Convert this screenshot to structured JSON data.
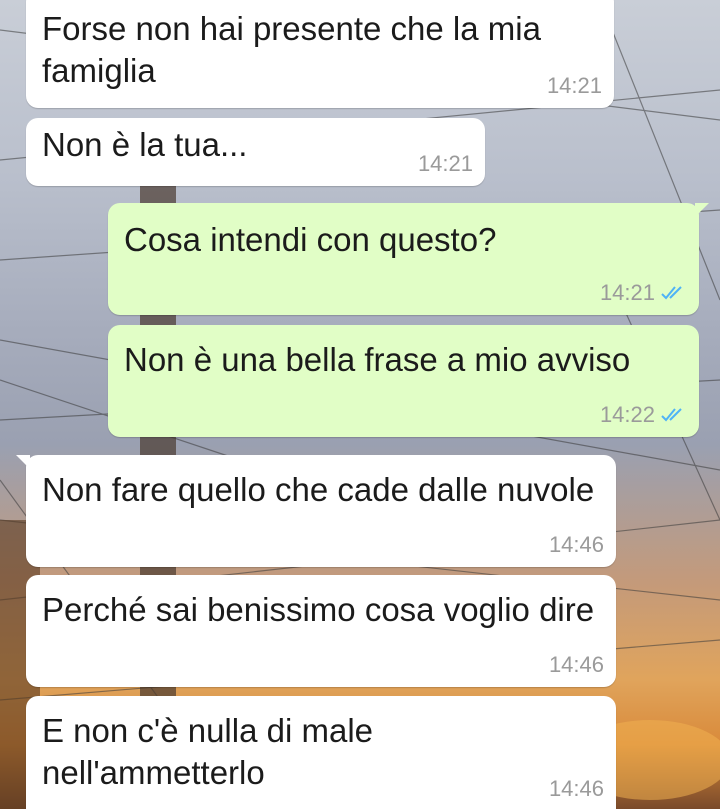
{
  "messages": [
    {
      "direction": "in",
      "text": "Forse non hai presente che la mia famiglia",
      "time": "14:21"
    },
    {
      "direction": "in",
      "text": "Non è la tua...",
      "time": "14:21"
    },
    {
      "direction": "out",
      "text": "Cosa intendi con questo?",
      "time": "14:21",
      "status": "read"
    },
    {
      "direction": "out",
      "text": "Non è una bella frase a mio avviso",
      "time": "14:22",
      "status": "read"
    },
    {
      "direction": "in",
      "text": "Non fare quello che cade dalle nuvole",
      "time": "14:46"
    },
    {
      "direction": "in",
      "text": "Perché sai benissimo cosa voglio dire",
      "time": "14:46"
    },
    {
      "direction": "in",
      "text": "E non c'è nulla di male nell'ammetterlo",
      "time": "14:46"
    }
  ],
  "colors": {
    "incoming_bubble": "#ffffff",
    "outgoing_bubble": "#e1fec6",
    "read_receipt": "#4fb3f6"
  },
  "icons": {
    "read_receipt": "double-check-icon"
  }
}
